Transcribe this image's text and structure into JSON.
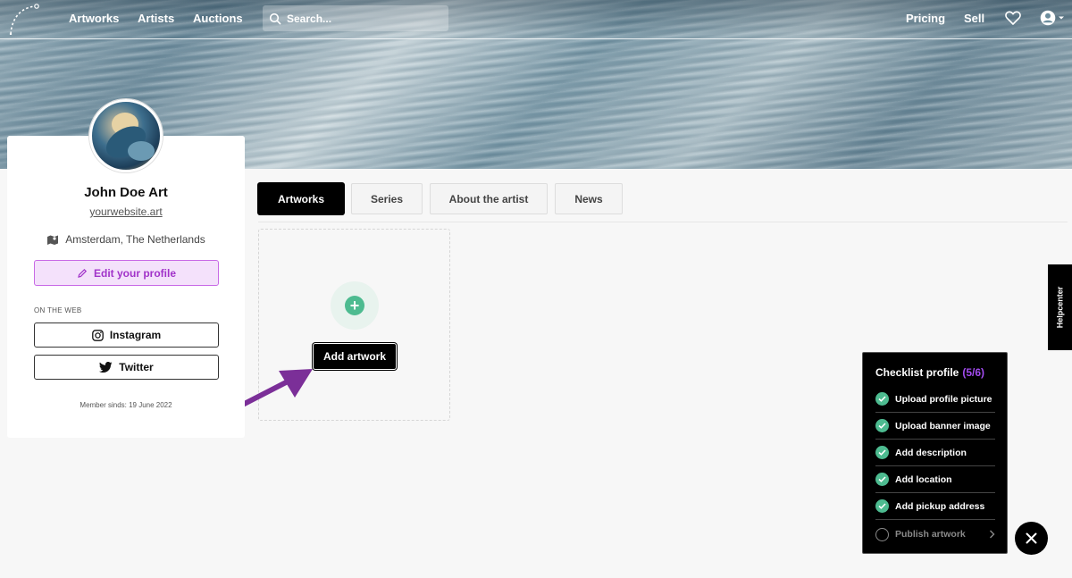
{
  "nav": {
    "links": [
      "Artworks",
      "Artists",
      "Auctions"
    ],
    "search_placeholder": "Search...",
    "right_links": [
      "Pricing",
      "Sell"
    ]
  },
  "profile": {
    "name": "John Doe Art",
    "website": "yourwebsite.art",
    "location": "Amsterdam, The Netherlands",
    "edit_label": "Edit your profile",
    "on_the_web": "ON THE WEB",
    "social": [
      "Instagram",
      "Twitter"
    ],
    "member_since": "Member sinds: 19 June 2022"
  },
  "tabs": [
    "Artworks",
    "Series",
    "About the artist",
    "News"
  ],
  "add_artwork": {
    "label": "Add artwork",
    "plus": "+"
  },
  "helpcenter": "Helpcenter",
  "checklist": {
    "title": "Checklist profile",
    "count": "(5/6)",
    "items": [
      "Upload profile picture",
      "Upload banner image",
      "Add description",
      "Add location",
      "Add pickup address",
      "Publish artwork"
    ]
  },
  "colors": {
    "accent_purple": "#a133c9",
    "check_green": "#4dbb90",
    "arrow_purple": "#7b2f98"
  }
}
